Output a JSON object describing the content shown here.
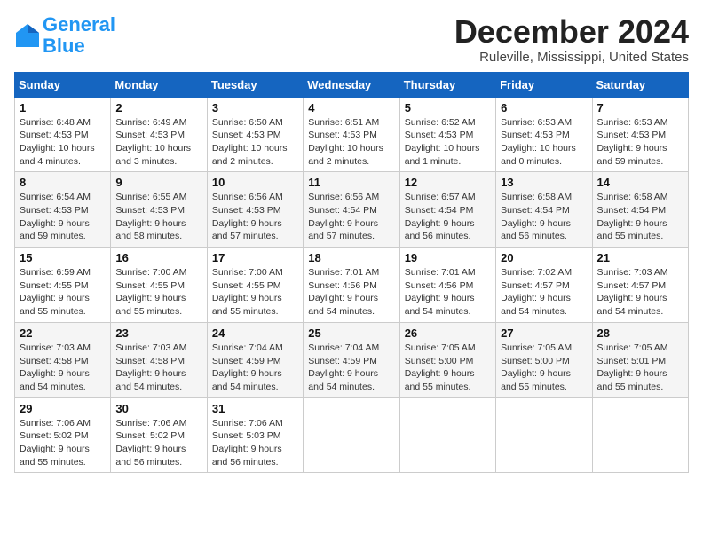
{
  "logo": {
    "line1": "General",
    "line2": "Blue"
  },
  "title": "December 2024",
  "location": "Ruleville, Mississippi, United States",
  "weekdays": [
    "Sunday",
    "Monday",
    "Tuesday",
    "Wednesday",
    "Thursday",
    "Friday",
    "Saturday"
  ],
  "weeks": [
    [
      {
        "day": "1",
        "info": "Sunrise: 6:48 AM\nSunset: 4:53 PM\nDaylight: 10 hours\nand 4 minutes."
      },
      {
        "day": "2",
        "info": "Sunrise: 6:49 AM\nSunset: 4:53 PM\nDaylight: 10 hours\nand 3 minutes."
      },
      {
        "day": "3",
        "info": "Sunrise: 6:50 AM\nSunset: 4:53 PM\nDaylight: 10 hours\nand 2 minutes."
      },
      {
        "day": "4",
        "info": "Sunrise: 6:51 AM\nSunset: 4:53 PM\nDaylight: 10 hours\nand 2 minutes."
      },
      {
        "day": "5",
        "info": "Sunrise: 6:52 AM\nSunset: 4:53 PM\nDaylight: 10 hours\nand 1 minute."
      },
      {
        "day": "6",
        "info": "Sunrise: 6:53 AM\nSunset: 4:53 PM\nDaylight: 10 hours\nand 0 minutes."
      },
      {
        "day": "7",
        "info": "Sunrise: 6:53 AM\nSunset: 4:53 PM\nDaylight: 9 hours\nand 59 minutes."
      }
    ],
    [
      {
        "day": "8",
        "info": "Sunrise: 6:54 AM\nSunset: 4:53 PM\nDaylight: 9 hours\nand 59 minutes."
      },
      {
        "day": "9",
        "info": "Sunrise: 6:55 AM\nSunset: 4:53 PM\nDaylight: 9 hours\nand 58 minutes."
      },
      {
        "day": "10",
        "info": "Sunrise: 6:56 AM\nSunset: 4:53 PM\nDaylight: 9 hours\nand 57 minutes."
      },
      {
        "day": "11",
        "info": "Sunrise: 6:56 AM\nSunset: 4:54 PM\nDaylight: 9 hours\nand 57 minutes."
      },
      {
        "day": "12",
        "info": "Sunrise: 6:57 AM\nSunset: 4:54 PM\nDaylight: 9 hours\nand 56 minutes."
      },
      {
        "day": "13",
        "info": "Sunrise: 6:58 AM\nSunset: 4:54 PM\nDaylight: 9 hours\nand 56 minutes."
      },
      {
        "day": "14",
        "info": "Sunrise: 6:58 AM\nSunset: 4:54 PM\nDaylight: 9 hours\nand 55 minutes."
      }
    ],
    [
      {
        "day": "15",
        "info": "Sunrise: 6:59 AM\nSunset: 4:55 PM\nDaylight: 9 hours\nand 55 minutes."
      },
      {
        "day": "16",
        "info": "Sunrise: 7:00 AM\nSunset: 4:55 PM\nDaylight: 9 hours\nand 55 minutes."
      },
      {
        "day": "17",
        "info": "Sunrise: 7:00 AM\nSunset: 4:55 PM\nDaylight: 9 hours\nand 55 minutes."
      },
      {
        "day": "18",
        "info": "Sunrise: 7:01 AM\nSunset: 4:56 PM\nDaylight: 9 hours\nand 54 minutes."
      },
      {
        "day": "19",
        "info": "Sunrise: 7:01 AM\nSunset: 4:56 PM\nDaylight: 9 hours\nand 54 minutes."
      },
      {
        "day": "20",
        "info": "Sunrise: 7:02 AM\nSunset: 4:57 PM\nDaylight: 9 hours\nand 54 minutes."
      },
      {
        "day": "21",
        "info": "Sunrise: 7:03 AM\nSunset: 4:57 PM\nDaylight: 9 hours\nand 54 minutes."
      }
    ],
    [
      {
        "day": "22",
        "info": "Sunrise: 7:03 AM\nSunset: 4:58 PM\nDaylight: 9 hours\nand 54 minutes."
      },
      {
        "day": "23",
        "info": "Sunrise: 7:03 AM\nSunset: 4:58 PM\nDaylight: 9 hours\nand 54 minutes."
      },
      {
        "day": "24",
        "info": "Sunrise: 7:04 AM\nSunset: 4:59 PM\nDaylight: 9 hours\nand 54 minutes."
      },
      {
        "day": "25",
        "info": "Sunrise: 7:04 AM\nSunset: 4:59 PM\nDaylight: 9 hours\nand 54 minutes."
      },
      {
        "day": "26",
        "info": "Sunrise: 7:05 AM\nSunset: 5:00 PM\nDaylight: 9 hours\nand 55 minutes."
      },
      {
        "day": "27",
        "info": "Sunrise: 7:05 AM\nSunset: 5:00 PM\nDaylight: 9 hours\nand 55 minutes."
      },
      {
        "day": "28",
        "info": "Sunrise: 7:05 AM\nSunset: 5:01 PM\nDaylight: 9 hours\nand 55 minutes."
      }
    ],
    [
      {
        "day": "29",
        "info": "Sunrise: 7:06 AM\nSunset: 5:02 PM\nDaylight: 9 hours\nand 55 minutes."
      },
      {
        "day": "30",
        "info": "Sunrise: 7:06 AM\nSunset: 5:02 PM\nDaylight: 9 hours\nand 56 minutes."
      },
      {
        "day": "31",
        "info": "Sunrise: 7:06 AM\nSunset: 5:03 PM\nDaylight: 9 hours\nand 56 minutes."
      },
      null,
      null,
      null,
      null
    ]
  ]
}
